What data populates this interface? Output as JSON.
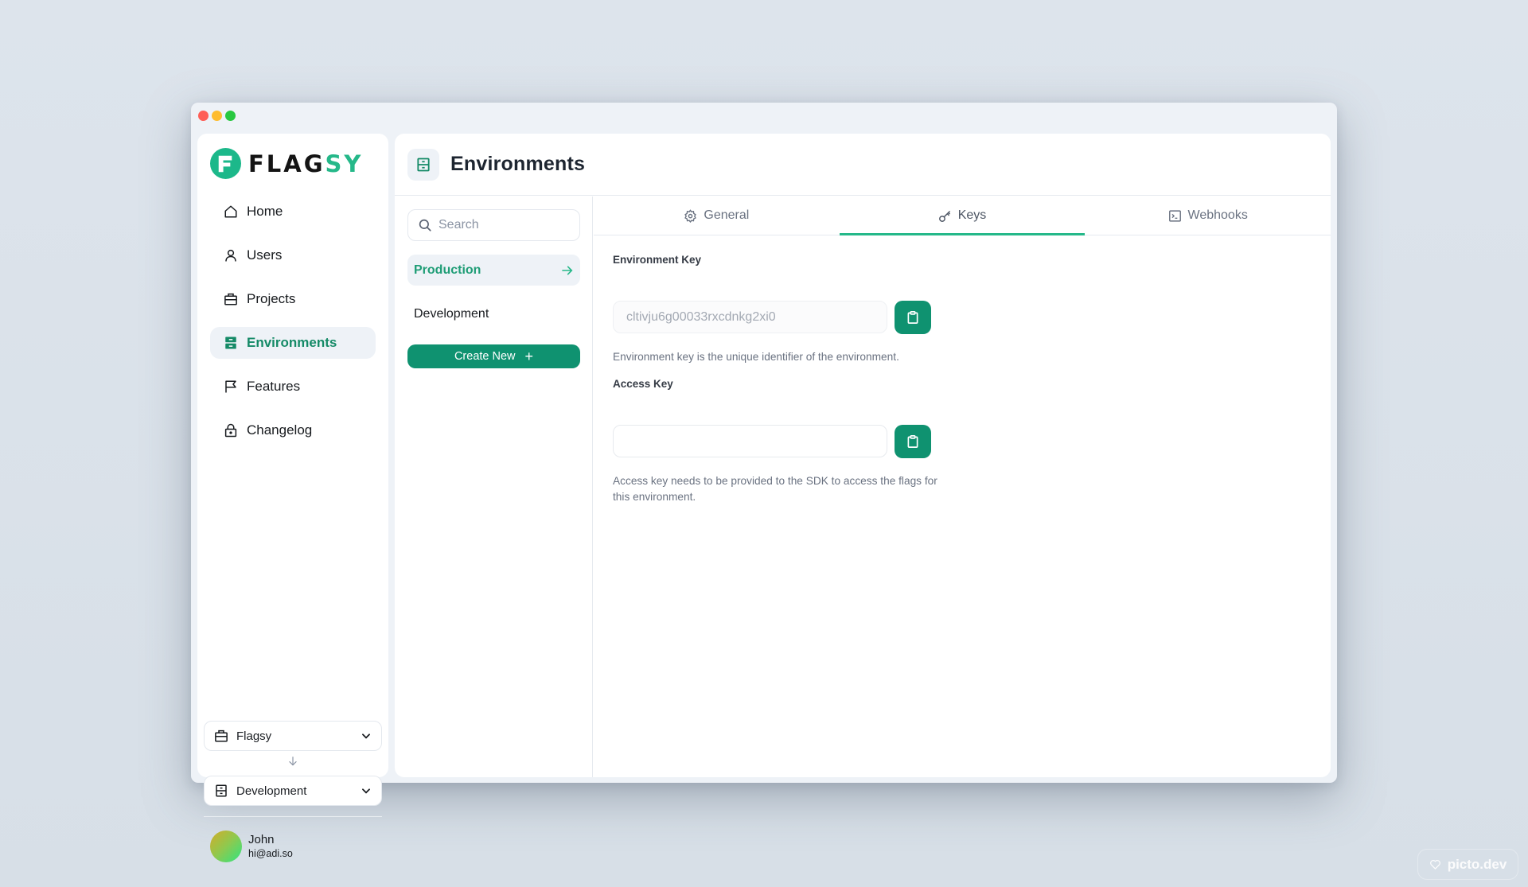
{
  "window": {
    "traffic_lights": [
      "close",
      "minimize",
      "maximize"
    ]
  },
  "brand": {
    "name_part1": "FLAG",
    "name_part2": "SY",
    "accent_color": "#25b889",
    "button_color": "#0f9270"
  },
  "sidebar": {
    "items": [
      {
        "label": "Home",
        "icon": "home-icon",
        "active": false
      },
      {
        "label": "Users",
        "icon": "user-icon",
        "active": false
      },
      {
        "label": "Projects",
        "icon": "briefcase-icon",
        "active": false
      },
      {
        "label": "Environments",
        "icon": "server-icon",
        "active": true
      },
      {
        "label": "Features",
        "icon": "flag-icon",
        "active": false
      },
      {
        "label": "Changelog",
        "icon": "lock-icon",
        "active": false
      }
    ],
    "project_switcher": {
      "value": "Flagsy",
      "icon": "briefcase-icon"
    },
    "environment_switcher": {
      "value": "Development",
      "icon": "server-icon"
    },
    "user": {
      "name": "John",
      "email": "hi@adi.so"
    }
  },
  "header": {
    "title": "Environments",
    "icon": "server-icon"
  },
  "environment_list": {
    "search_placeholder": "Search",
    "search_value": "",
    "items": [
      {
        "label": "Production",
        "active": true
      },
      {
        "label": "Development",
        "active": false
      }
    ],
    "create_button": "Create New",
    "create_icon": "+"
  },
  "tabs": [
    {
      "label": "General",
      "icon": "gear-icon",
      "active": false
    },
    {
      "label": "Keys",
      "icon": "key-icon",
      "active": true
    },
    {
      "label": "Webhooks",
      "icon": "terminal-icon",
      "active": false
    }
  ],
  "keys": {
    "environment_key": {
      "label": "Environment Key",
      "value": "cltivju6g00033rxcdnkg2xi0",
      "help": "Environment key is the unique identifier of the environment."
    },
    "access_key": {
      "label": "Access Key",
      "value": "",
      "help": "Access key needs to be provided to the SDK to access the flags for this environment."
    }
  },
  "watermark": {
    "text": "picto.dev"
  }
}
